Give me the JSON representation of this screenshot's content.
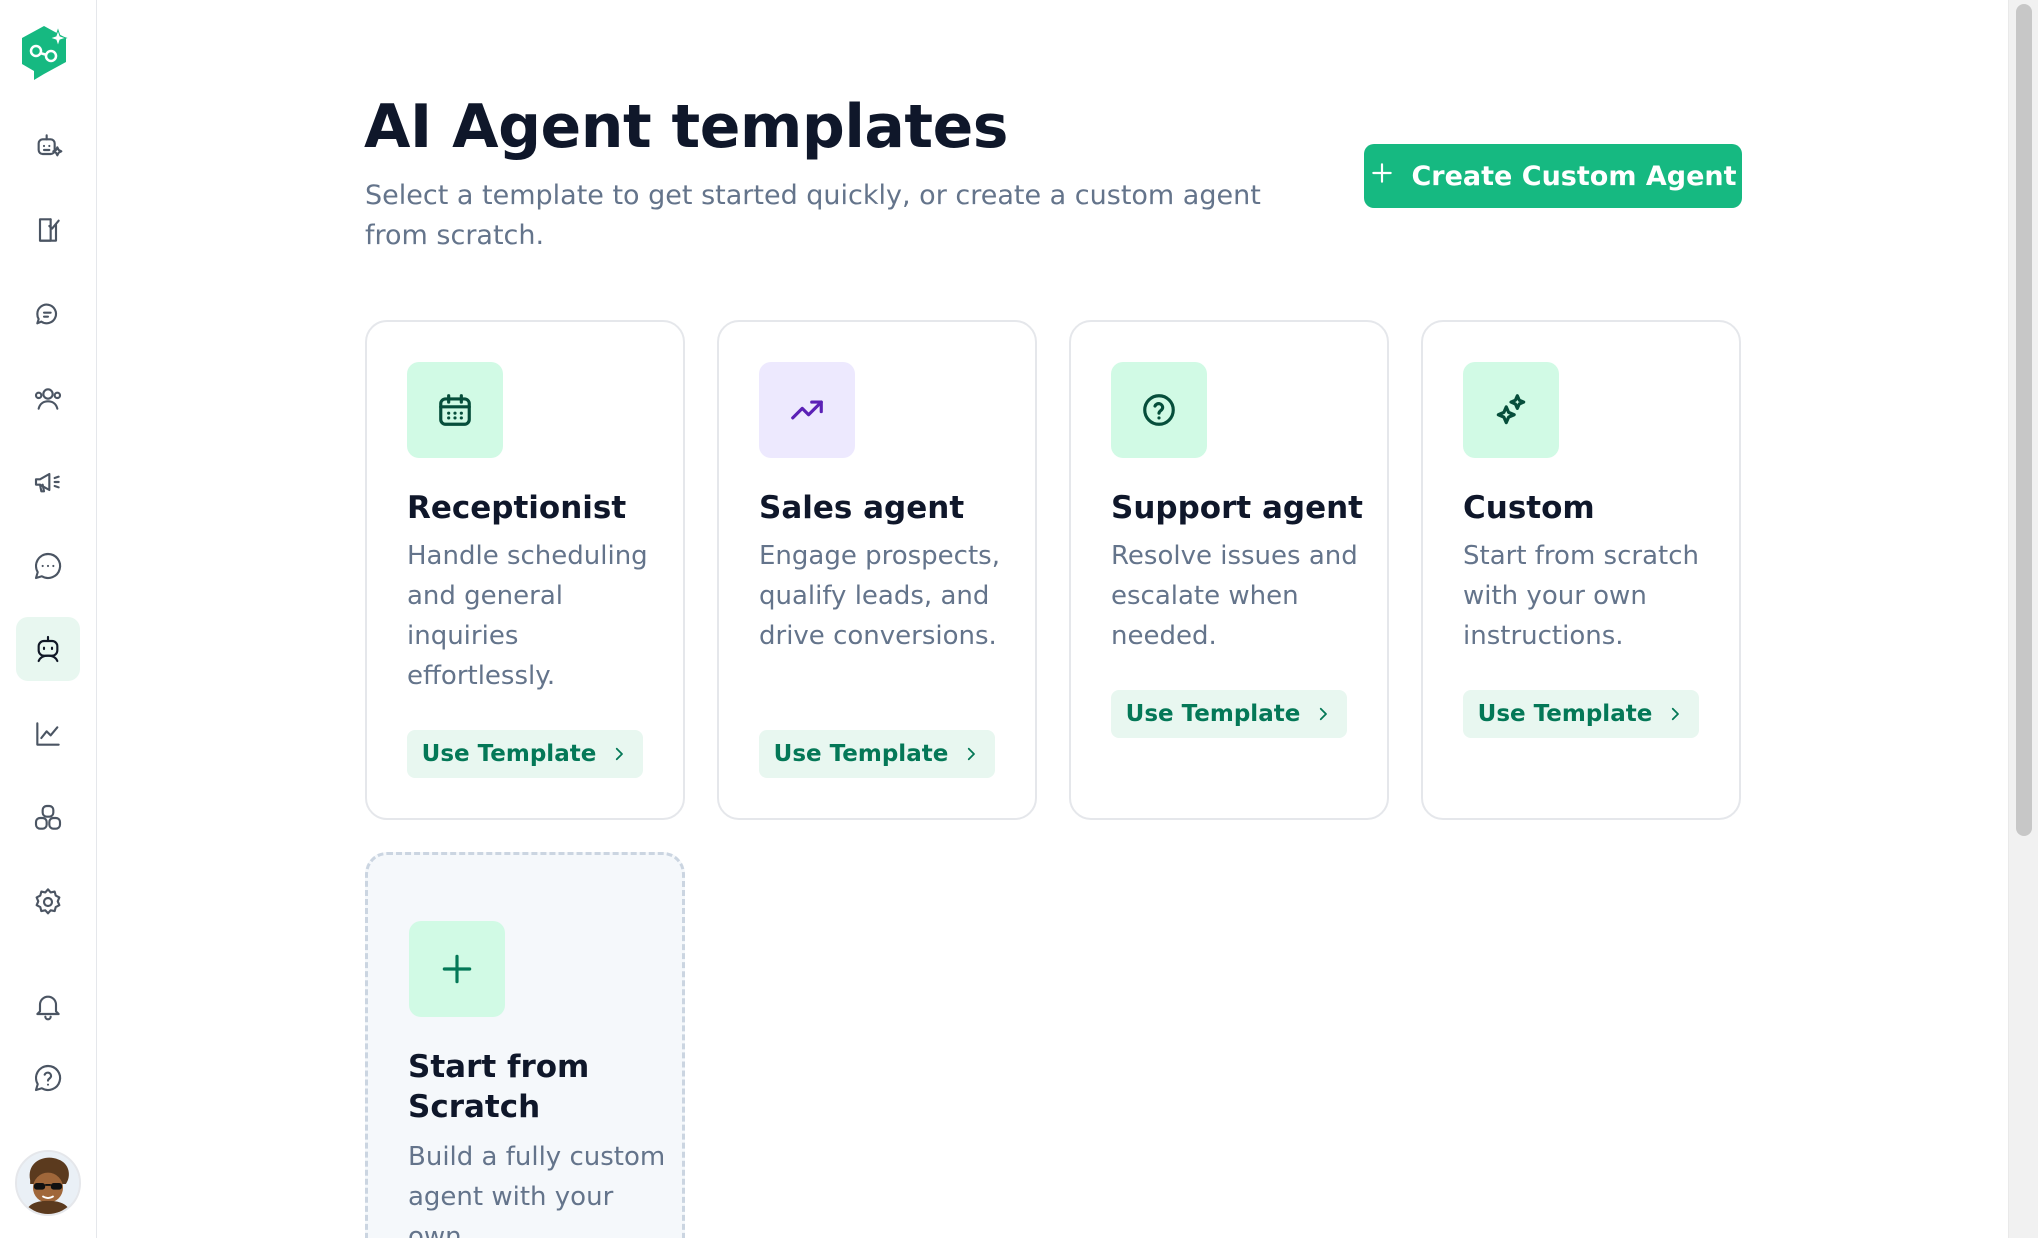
{
  "page": {
    "title": "AI Agent templates",
    "subtitle": "Select a template to get started quickly, or create a custom agent from scratch.",
    "create_button_label": "Create Custom Agent"
  },
  "sidebar": {
    "items": [
      {
        "icon": "agent-spark-icon"
      },
      {
        "icon": "checklist-icon"
      },
      {
        "icon": "chat-bubbles-icon"
      },
      {
        "icon": "contacts-icon"
      },
      {
        "icon": "megaphone-icon"
      },
      {
        "icon": "message-dots-icon"
      },
      {
        "icon": "robot-icon",
        "active": true
      },
      {
        "icon": "line-chart-icon"
      },
      {
        "icon": "integrations-icon"
      },
      {
        "icon": "gear-icon"
      },
      {
        "icon": "bell-icon"
      },
      {
        "icon": "help-icon"
      }
    ]
  },
  "templates": [
    {
      "title": "Receptionist",
      "description": "Handle scheduling and general inquiries effortlessly.",
      "button": "Use Template",
      "icon": "calendar-icon",
      "icon_bg": "#d1fae5",
      "icon_color": "#064e3b"
    },
    {
      "title": "Sales agent",
      "description": "Engage prospects, qualify leads, and drive conversions.",
      "button": "Use Template",
      "icon": "trending-up-icon",
      "icon_bg": "#ede9fe",
      "icon_color": "#5b21b6"
    },
    {
      "title": "Support agent",
      "description": "Resolve issues and escalate when needed.",
      "button": "Use Template",
      "icon": "question-circle-icon",
      "icon_bg": "#d1fae5",
      "icon_color": "#064e3b"
    },
    {
      "title": "Custom",
      "description": "Start from scratch with your own instructions.",
      "button": "Use Template",
      "icon": "sparkles-icon",
      "icon_bg": "#d1fae5",
      "icon_color": "#064e3b"
    }
  ],
  "scratch": {
    "title": "Start from Scratch",
    "description": "Build a fully custom agent with your own",
    "icon": "plus-icon"
  }
}
